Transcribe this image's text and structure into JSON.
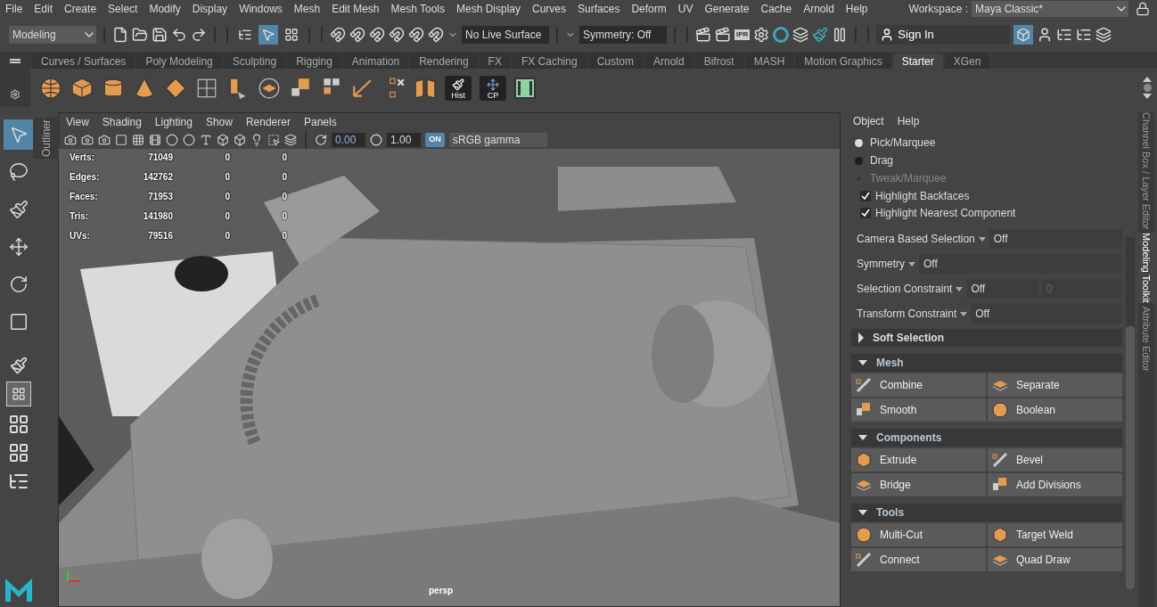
{
  "menu_bar": {
    "items": [
      "File",
      "Edit",
      "Create",
      "Select",
      "Modify",
      "Display",
      "Windows",
      "Mesh",
      "Edit Mesh",
      "Mesh Tools",
      "Mesh Display",
      "Curves",
      "Surfaces",
      "Deform",
      "UV",
      "Generate",
      "Cache",
      "Arnold",
      "Help"
    ],
    "workspace_label": "Workspace :",
    "workspace_value": "Maya Classic*"
  },
  "status_line": {
    "mode": "Modeling",
    "select_masks": [
      {
        "kind": "hierarchy",
        "selected": false
      },
      {
        "kind": "object",
        "selected": true
      },
      {
        "kind": "component",
        "selected": false
      }
    ],
    "live_surface": "No Live Surface",
    "symmetry": "Symmetry: Off",
    "ipr": "IPR",
    "sign_in": "Sign In"
  },
  "shelf": {
    "tabs": [
      {
        "label": "Curves / Surfaces",
        "selected": false
      },
      {
        "label": "Poly Modeling",
        "selected": false
      },
      {
        "label": "Sculpting",
        "selected": false
      },
      {
        "label": "Rigging",
        "selected": false
      },
      {
        "label": "Animation",
        "selected": false
      },
      {
        "label": "Rendering",
        "selected": false
      },
      {
        "label": "FX",
        "selected": false
      },
      {
        "label": "FX Caching",
        "selected": false
      },
      {
        "label": "Custom",
        "selected": false
      },
      {
        "label": "Arnold",
        "selected": false
      },
      {
        "label": "Bifrost",
        "selected": false
      },
      {
        "label": "MASH",
        "selected": false
      },
      {
        "label": "Motion Graphics",
        "selected": false
      },
      {
        "label": "Starter",
        "selected": true
      },
      {
        "label": "XGen",
        "selected": false
      }
    ],
    "hist": "Hist",
    "cp": "CP"
  },
  "toolbox": [
    {
      "kind": "select",
      "selected": true
    },
    {
      "kind": "lasso",
      "selected": false
    },
    {
      "kind": "paint",
      "selected": false
    },
    {
      "kind": "move",
      "selected": false
    },
    {
      "kind": "rotate",
      "selected": false
    },
    {
      "kind": "scale",
      "selected": false
    }
  ],
  "outliner_tab": "Outliner",
  "viewport": {
    "menu": [
      "View",
      "Shading",
      "Lighting",
      "Show",
      "Renderer",
      "Panels"
    ],
    "exposure": "0.00",
    "gamma": "1.00",
    "view_transform_badge": "ON",
    "color_space": "sRGB gamma",
    "hud": [
      {
        "label": "Verts:",
        "values": [
          "71049",
          "0",
          "0"
        ]
      },
      {
        "label": "Edges:",
        "values": [
          "142762",
          "0",
          "0"
        ]
      },
      {
        "label": "Faces:",
        "values": [
          "71953",
          "0",
          "0"
        ]
      },
      {
        "label": "Tris:",
        "values": [
          "141980",
          "0",
          "0"
        ]
      },
      {
        "label": "UVs:",
        "values": [
          "79516",
          "0",
          "0"
        ]
      }
    ],
    "camera": "persp"
  },
  "toolkit": {
    "menu": [
      "Object",
      "Help"
    ],
    "pick_modes": [
      {
        "label": "Pick/Marquee",
        "selected": true,
        "disabled": false
      },
      {
        "label": "Drag",
        "selected": false,
        "disabled": false
      },
      {
        "label": "Tweak/Marquee",
        "selected": false,
        "disabled": true
      }
    ],
    "options": [
      {
        "label": "Highlight Backfaces",
        "checked": true
      },
      {
        "label": "Highlight Nearest Component",
        "checked": true
      }
    ],
    "dropdowns": [
      {
        "label": "Camera Based Selection",
        "value": "Off"
      },
      {
        "label": "Symmetry",
        "value": "Off"
      },
      {
        "label": "Selection Constraint",
        "value": "Off",
        "extra": "0"
      },
      {
        "label": "Transform Constraint",
        "value": "Off"
      }
    ],
    "sections": [
      {
        "title": "Soft Selection",
        "expanded": false
      },
      {
        "title": "Mesh",
        "expanded": true,
        "buttons": [
          "Combine",
          "Separate",
          "Smooth",
          "Boolean"
        ]
      },
      {
        "title": "Components",
        "expanded": true,
        "buttons": [
          "Extrude",
          "Bevel",
          "Bridge",
          "Add Divisions"
        ]
      },
      {
        "title": "Tools",
        "expanded": true,
        "buttons": [
          "Multi-Cut",
          "Target Weld",
          "Connect",
          "Quad Draw"
        ]
      }
    ]
  },
  "side_tabs": [
    {
      "label": "Channel Box / Layer Editor",
      "selected": false
    },
    {
      "label": "Modeling Toolkit",
      "selected": true
    },
    {
      "label": "Attribute Editor",
      "selected": false
    }
  ]
}
